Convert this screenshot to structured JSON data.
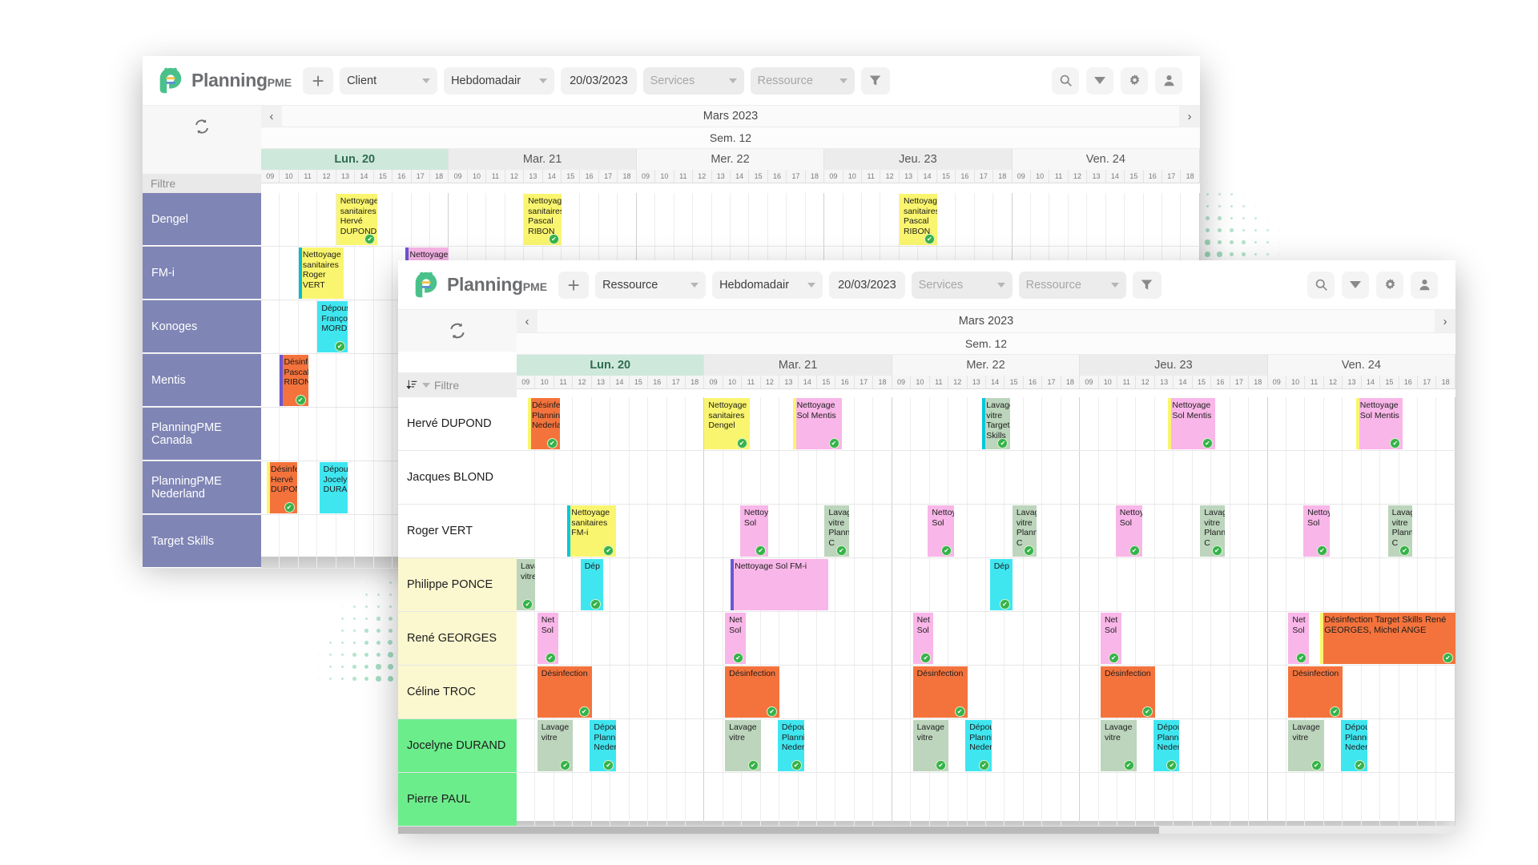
{
  "brand": {
    "name": "Planning",
    "suffix": "PME"
  },
  "colors": {
    "accent": "#4ac18a",
    "today": "#cfe8dc",
    "yellow": "#faf56e",
    "pink": "#f9b6e8",
    "orange": "#f4733c",
    "cyan": "#3fe6f0",
    "green_pale": "#bcd5bc",
    "grouplabel": "#7f85b5"
  },
  "back_window": {
    "toolbar": {
      "add_label": "+",
      "entity": "Client",
      "period": "Hebdomadair",
      "date": "20/03/2023",
      "services": "Services",
      "resource": "Ressource",
      "filter_icon": "funnel-icon",
      "search_icon": "search-icon",
      "dropdown_icon": "chevron-down-icon",
      "settings_icon": "gear-icon",
      "user_icon": "user-icon"
    },
    "refresh_icon": "refresh-icon",
    "month": "Mars 2023",
    "week": "Sem. 12",
    "prev": "‹",
    "next": "›",
    "filter_placeholder": "Filtre",
    "days": [
      "Lun. 20",
      "Mar. 21",
      "Mer. 22",
      "Jeu. 23",
      "Ven. 24"
    ],
    "hours": [
      "09",
      "10",
      "11",
      "12",
      "13",
      "14",
      "15",
      "16",
      "17",
      "18"
    ],
    "rows": [
      {
        "label": "Dengel"
      },
      {
        "label": "FM-i"
      },
      {
        "label": "Konoges"
      },
      {
        "label": "Mentis"
      },
      {
        "label": "PlanningPME Canada"
      },
      {
        "label": "PlanningPME Nederland"
      },
      {
        "label": "Target Skills"
      }
    ],
    "events": [
      {
        "row": 0,
        "day": 0,
        "start": 13.0,
        "end": 15.2,
        "title": "Nettoyage sanitaires Hervé DUPOND",
        "color": "#faf56e",
        "bar": "#faf56e",
        "check": true
      },
      {
        "row": 0,
        "day": 1,
        "start": 13.0,
        "end": 15.0,
        "title": "Nettoyage sanitaires Pascal RIBON",
        "color": "#faf56e",
        "bar": "#faf56e",
        "check": true
      },
      {
        "row": 0,
        "day": 3,
        "start": 13.0,
        "end": 15.0,
        "title": "Nettoyage sanitaires Pascal RIBON",
        "color": "#faf56e",
        "bar": "#faf56e",
        "check": true
      },
      {
        "row": 1,
        "day": 0,
        "start": 11.0,
        "end": 13.4,
        "title": "Nettoyage sanitaires Roger VERT",
        "color": "#faf56e",
        "bar": "#00bcd4",
        "check": false
      },
      {
        "row": 1,
        "day": 0,
        "start": 16.7,
        "end": 19.0,
        "title": "Nettoyage Sol Philippe PONCE",
        "color": "#f9b6e8",
        "bar": "#6a57d5",
        "check": false
      },
      {
        "row": 2,
        "day": 0,
        "start": 12.0,
        "end": 13.6,
        "title": "Dépoussi François MORDE",
        "color": "#3fe6f0",
        "bar": "#3fe6f0",
        "check": true
      },
      {
        "row": 3,
        "day": 0,
        "start": 10.0,
        "end": 11.5,
        "title": "Désinfec Pascal RIBON",
        "color": "#f4733c",
        "bar": "#6a57d5",
        "check": true
      },
      {
        "row": 5,
        "day": 0,
        "start": 9.3,
        "end": 10.9,
        "title": "Désinfec Hervé DUPOND",
        "color": "#f4733c",
        "bar": "#faf56e",
        "check": true
      },
      {
        "row": 5,
        "day": 0,
        "start": 12.1,
        "end": 13.6,
        "title": "Dépous Jocely DURA",
        "color": "#3fe6f0",
        "bar": "#3fe6f0",
        "check": false
      }
    ]
  },
  "front_window": {
    "toolbar": {
      "add_label": "+",
      "entity": "Ressource",
      "period": "Hebdomadair",
      "date": "20/03/2023",
      "services": "Services",
      "resource": "Ressource",
      "filter_icon": "funnel-icon",
      "search_icon": "search-icon",
      "dropdown_icon": "chevron-down-icon",
      "settings_icon": "gear-icon",
      "user_icon": "user-icon"
    },
    "refresh_icon": "refresh-icon",
    "sort_icon": "sort-icon",
    "month": "Mars 2023",
    "week": "Sem. 12",
    "prev": "‹",
    "next": "›",
    "filter_placeholder": "Filtre",
    "days": [
      "Lun. 20",
      "Mar. 21",
      "Mer. 22",
      "Jeu. 23",
      "Ven. 24"
    ],
    "hours": [
      "09",
      "10",
      "11",
      "12",
      "13",
      "14",
      "15",
      "16",
      "17",
      "18"
    ],
    "rows": [
      {
        "label": "Hervé DUPOND",
        "bg": "#ffffff"
      },
      {
        "label": "Jacques BLOND",
        "bg": "#ffffff"
      },
      {
        "label": "Roger VERT",
        "bg": "#ffffff"
      },
      {
        "label": "Philippe PONCE",
        "bg": "#fbf7cf"
      },
      {
        "label": "René GEORGES",
        "bg": "#fbf7cf"
      },
      {
        "label": "Céline TROC",
        "bg": "#fbf7cf"
      },
      {
        "label": "Jocelyne DURAND",
        "bg": "#6ced8c"
      },
      {
        "label": "Pierre PAUL",
        "bg": "#6ced8c"
      }
    ],
    "events": [
      {
        "row": 0,
        "day": 0,
        "start": 9.6,
        "end": 11.3,
        "title": "Désinfec Planning Nederla",
        "color": "#f4733c",
        "bar": "#faf56e",
        "check": true
      },
      {
        "row": 0,
        "day": 1,
        "start": 9.0,
        "end": 11.4,
        "title": "Nettoyage sanitaires Dengel",
        "color": "#faf56e",
        "bar": "#faf56e",
        "check": true
      },
      {
        "row": 0,
        "day": 1,
        "start": 13.7,
        "end": 16.3,
        "title": "Nettoyage Sol Mentis",
        "color": "#f9b6e8",
        "bar": "#faf56e",
        "check": true
      },
      {
        "row": 0,
        "day": 2,
        "start": 13.8,
        "end": 15.3,
        "title": "Lavage vitre Target Skills",
        "color": "#bcd5bc",
        "bar": "#00c8dd",
        "check": true
      },
      {
        "row": 0,
        "day": 3,
        "start": 13.7,
        "end": 16.2,
        "title": "Nettoyage Sol Mentis",
        "color": "#f9b6e8",
        "bar": "#faf56e",
        "check": true
      },
      {
        "row": 0,
        "day": 4,
        "start": 13.7,
        "end": 16.2,
        "title": "Nettoyage Sol Mentis",
        "color": "#f9b6e8",
        "bar": "#faf56e",
        "check": true
      },
      {
        "row": 2,
        "day": 0,
        "start": 11.7,
        "end": 14.3,
        "title": "Nettoyage sanitaires FM-i",
        "color": "#faf56e",
        "bar": "#00c8dd",
        "check": true
      },
      {
        "row": 2,
        "day": 1,
        "start": 10.9,
        "end": 12.4,
        "title": "Nettoyage Sol",
        "color": "#f9b6e8",
        "bar": "#f9b6e8",
        "check": true
      },
      {
        "row": 2,
        "day": 1,
        "start": 15.4,
        "end": 16.7,
        "title": "Lavage vitre Planning C",
        "color": "#bcd5bc",
        "bar": "#bcd5bc",
        "check": true
      },
      {
        "row": 2,
        "day": 2,
        "start": 10.9,
        "end": 12.3,
        "title": "Nettoyage Sol",
        "color": "#f9b6e8",
        "bar": "#f9b6e8",
        "check": true
      },
      {
        "row": 2,
        "day": 2,
        "start": 15.4,
        "end": 16.7,
        "title": "Lavage vitre Planning C",
        "color": "#bcd5bc",
        "bar": "#bcd5bc",
        "check": true
      },
      {
        "row": 2,
        "day": 3,
        "start": 10.9,
        "end": 12.3,
        "title": "Nettoyage Sol",
        "color": "#f9b6e8",
        "bar": "#f9b6e8",
        "check": true
      },
      {
        "row": 2,
        "day": 3,
        "start": 15.4,
        "end": 16.7,
        "title": "Lavage vitre Planning C",
        "color": "#bcd5bc",
        "bar": "#bcd5bc",
        "check": true
      },
      {
        "row": 2,
        "day": 4,
        "start": 10.9,
        "end": 12.3,
        "title": "Nettoyage Sol",
        "color": "#f9b6e8",
        "bar": "#f9b6e8",
        "check": true
      },
      {
        "row": 2,
        "day": 4,
        "start": 15.4,
        "end": 16.7,
        "title": "Lavage vitre Planning C",
        "color": "#bcd5bc",
        "bar": "#bcd5bc",
        "check": true
      },
      {
        "row": 3,
        "day": 0,
        "start": 9.0,
        "end": 10.0,
        "title": "Lava vitre",
        "color": "#bcd5bc",
        "bar": "#bcd5bc",
        "check": true
      },
      {
        "row": 3,
        "day": 0,
        "start": 12.4,
        "end": 13.6,
        "title": "Dép",
        "color": "#3fe6f0",
        "bar": "#3fe6f0",
        "check": true
      },
      {
        "row": 3,
        "day": 1,
        "start": 10.4,
        "end": 15.6,
        "title": "Nettoyage Sol FM-i",
        "color": "#f9b6e8",
        "bar": "#6a57d5",
        "check": false
      },
      {
        "row": 3,
        "day": 2,
        "start": 14.2,
        "end": 15.4,
        "title": "Dép",
        "color": "#3fe6f0",
        "bar": "#3fe6f0",
        "check": true
      },
      {
        "row": 4,
        "day": 0,
        "start": 10.1,
        "end": 11.2,
        "title": "Net Sol",
        "color": "#f9b6e8",
        "bar": "#f9b6e8",
        "check": true
      },
      {
        "row": 4,
        "day": 1,
        "start": 10.1,
        "end": 11.2,
        "title": "Net Sol",
        "color": "#f9b6e8",
        "bar": "#f9b6e8",
        "check": true
      },
      {
        "row": 4,
        "day": 2,
        "start": 10.1,
        "end": 11.2,
        "title": "Net Sol",
        "color": "#f9b6e8",
        "bar": "#f9b6e8",
        "check": true
      },
      {
        "row": 4,
        "day": 3,
        "start": 10.1,
        "end": 11.2,
        "title": "Net Sol",
        "color": "#f9b6e8",
        "bar": "#f9b6e8",
        "check": true
      },
      {
        "row": 4,
        "day": 4,
        "start": 10.1,
        "end": 11.2,
        "title": "Net Sol",
        "color": "#f9b6e8",
        "bar": "#f9b6e8",
        "check": true
      },
      {
        "row": 4,
        "day": 4,
        "start": 11.8,
        "end": 19.0,
        "title": "Désinfection Target Skills René GEORGES, Michel ANGE",
        "color": "#f4733c",
        "bar": "#faf56e",
        "check": true,
        "wide": true
      },
      {
        "row": 5,
        "day": 0,
        "start": 10.1,
        "end": 13.0,
        "title": "Désinfection",
        "color": "#f4733c",
        "bar": "#f4733c",
        "check": true
      },
      {
        "row": 5,
        "day": 1,
        "start": 10.1,
        "end": 13.0,
        "title": "Désinfection",
        "color": "#f4733c",
        "bar": "#f4733c",
        "check": true
      },
      {
        "row": 5,
        "day": 2,
        "start": 10.1,
        "end": 13.0,
        "title": "Désinfection",
        "color": "#f4733c",
        "bar": "#f4733c",
        "check": true
      },
      {
        "row": 5,
        "day": 3,
        "start": 10.1,
        "end": 13.0,
        "title": "Désinfection",
        "color": "#f4733c",
        "bar": "#f4733c",
        "check": true
      },
      {
        "row": 5,
        "day": 4,
        "start": 10.1,
        "end": 13.0,
        "title": "Désinfection",
        "color": "#f4733c",
        "bar": "#f4733c",
        "check": true
      },
      {
        "row": 6,
        "day": 0,
        "start": 10.1,
        "end": 12.0,
        "title": "Lavage vitre",
        "color": "#bcd5bc",
        "bar": "#bcd5bc",
        "check": true
      },
      {
        "row": 6,
        "day": 0,
        "start": 12.9,
        "end": 14.3,
        "title": "Dépoussi Planning Nederlan",
        "color": "#3fe6f0",
        "bar": "#3fe6f0",
        "check": true
      },
      {
        "row": 6,
        "day": 1,
        "start": 10.1,
        "end": 12.0,
        "title": "Lavage vitre",
        "color": "#bcd5bc",
        "bar": "#bcd5bc",
        "check": true
      },
      {
        "row": 6,
        "day": 1,
        "start": 12.9,
        "end": 14.3,
        "title": "Dépoussi Planning Nederlan",
        "color": "#3fe6f0",
        "bar": "#3fe6f0",
        "check": true
      },
      {
        "row": 6,
        "day": 2,
        "start": 10.1,
        "end": 12.0,
        "title": "Lavage vitre",
        "color": "#bcd5bc",
        "bar": "#bcd5bc",
        "check": true
      },
      {
        "row": 6,
        "day": 2,
        "start": 12.9,
        "end": 14.3,
        "title": "Dépoussi Planning Nederlan",
        "color": "#3fe6f0",
        "bar": "#3fe6f0",
        "check": true
      },
      {
        "row": 6,
        "day": 3,
        "start": 10.1,
        "end": 12.0,
        "title": "Lavage vitre",
        "color": "#bcd5bc",
        "bar": "#bcd5bc",
        "check": true
      },
      {
        "row": 6,
        "day": 3,
        "start": 12.9,
        "end": 14.3,
        "title": "Dépoussi Planning Nederlan",
        "color": "#3fe6f0",
        "bar": "#3fe6f0",
        "check": true
      },
      {
        "row": 6,
        "day": 4,
        "start": 10.1,
        "end": 12.0,
        "title": "Lavage vitre",
        "color": "#bcd5bc",
        "bar": "#bcd5bc",
        "check": true
      },
      {
        "row": 6,
        "day": 4,
        "start": 12.9,
        "end": 14.3,
        "title": "Dépoussi Planning Nederlan",
        "color": "#3fe6f0",
        "bar": "#3fe6f0",
        "check": true
      }
    ]
  }
}
